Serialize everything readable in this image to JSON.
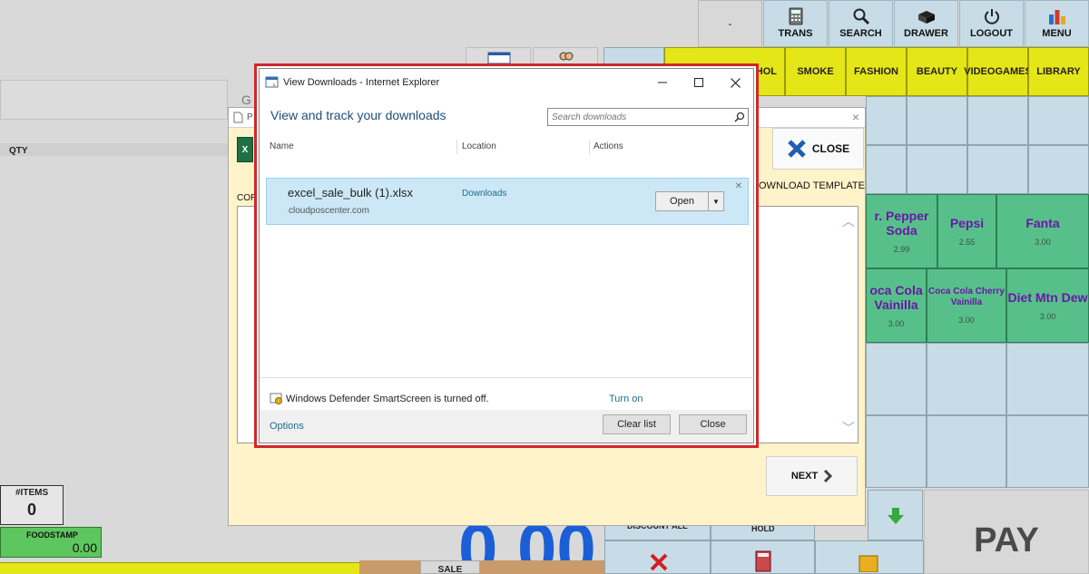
{
  "toolbar": {
    "dash_label": "-",
    "buttons": [
      {
        "label": "TRANS",
        "icon": "calculator-icon"
      },
      {
        "label": "SEARCH",
        "icon": "search-icon"
      },
      {
        "label": "DRAWER",
        "icon": "drawer-icon"
      },
      {
        "label": "LOGOUT",
        "icon": "power-icon"
      },
      {
        "label": "MENU",
        "icon": "bar-chart-icon"
      }
    ]
  },
  "categories": [
    "HOL",
    "SMOKE",
    "FASHION",
    "BEAUTY",
    "VIDEOGAMES",
    "LIBRARY"
  ],
  "products": [
    {
      "name": "r. Pepper Soda",
      "price": "2.99"
    },
    {
      "name": "Pepsi",
      "price": "2.55"
    },
    {
      "name": "Fanta",
      "price": "3.00"
    },
    {
      "name": "oca Cola Vainilla",
      "price": "3.00"
    },
    {
      "name": "Coca Cola Cherry Vainilla",
      "price": "3.00"
    },
    {
      "name": "Diet Mtn Dew",
      "price": "3.00"
    }
  ],
  "left_panel": {
    "qty_label": "QTY",
    "g_label": "G",
    "items_label": "#ITEMS",
    "items_count": "0",
    "foodstamp_label": "FOODSTAMP",
    "foodstamp_value": "0.00"
  },
  "total_display": "0.00",
  "bottom_buttons": {
    "discount_all": "DISCOUNT ALL",
    "hold": "HOLD",
    "sale": "SALE",
    "pay": "PAY"
  },
  "import_dialog": {
    "title_short": "P",
    "cor_label": "COR",
    "close_label": "CLOSE",
    "download_template": "OWNLOAD TEMPLATE",
    "next_label": "NEXT"
  },
  "ie_dialog": {
    "title": "View Downloads - Internet Explorer",
    "heading": "View and track your downloads",
    "search_placeholder": "Search downloads",
    "columns": {
      "name": "Name",
      "location": "Location",
      "actions": "Actions"
    },
    "download": {
      "filename": "excel_sale_bulk (1).xlsx",
      "source": "cloudposcenter.com",
      "location": "Downloads",
      "action": "Open"
    },
    "smartscreen_text": "Windows Defender SmartScreen is turned off.",
    "turn_on": "Turn on",
    "options": "Options",
    "clear_list": "Clear list",
    "close": "Close"
  },
  "colors": {
    "highlight_border": "#d0282c",
    "category_yellow": "#e5e617",
    "product_green": "#57c08a",
    "product_text": "#6a17a8",
    "total_blue": "#1a5fd6"
  }
}
